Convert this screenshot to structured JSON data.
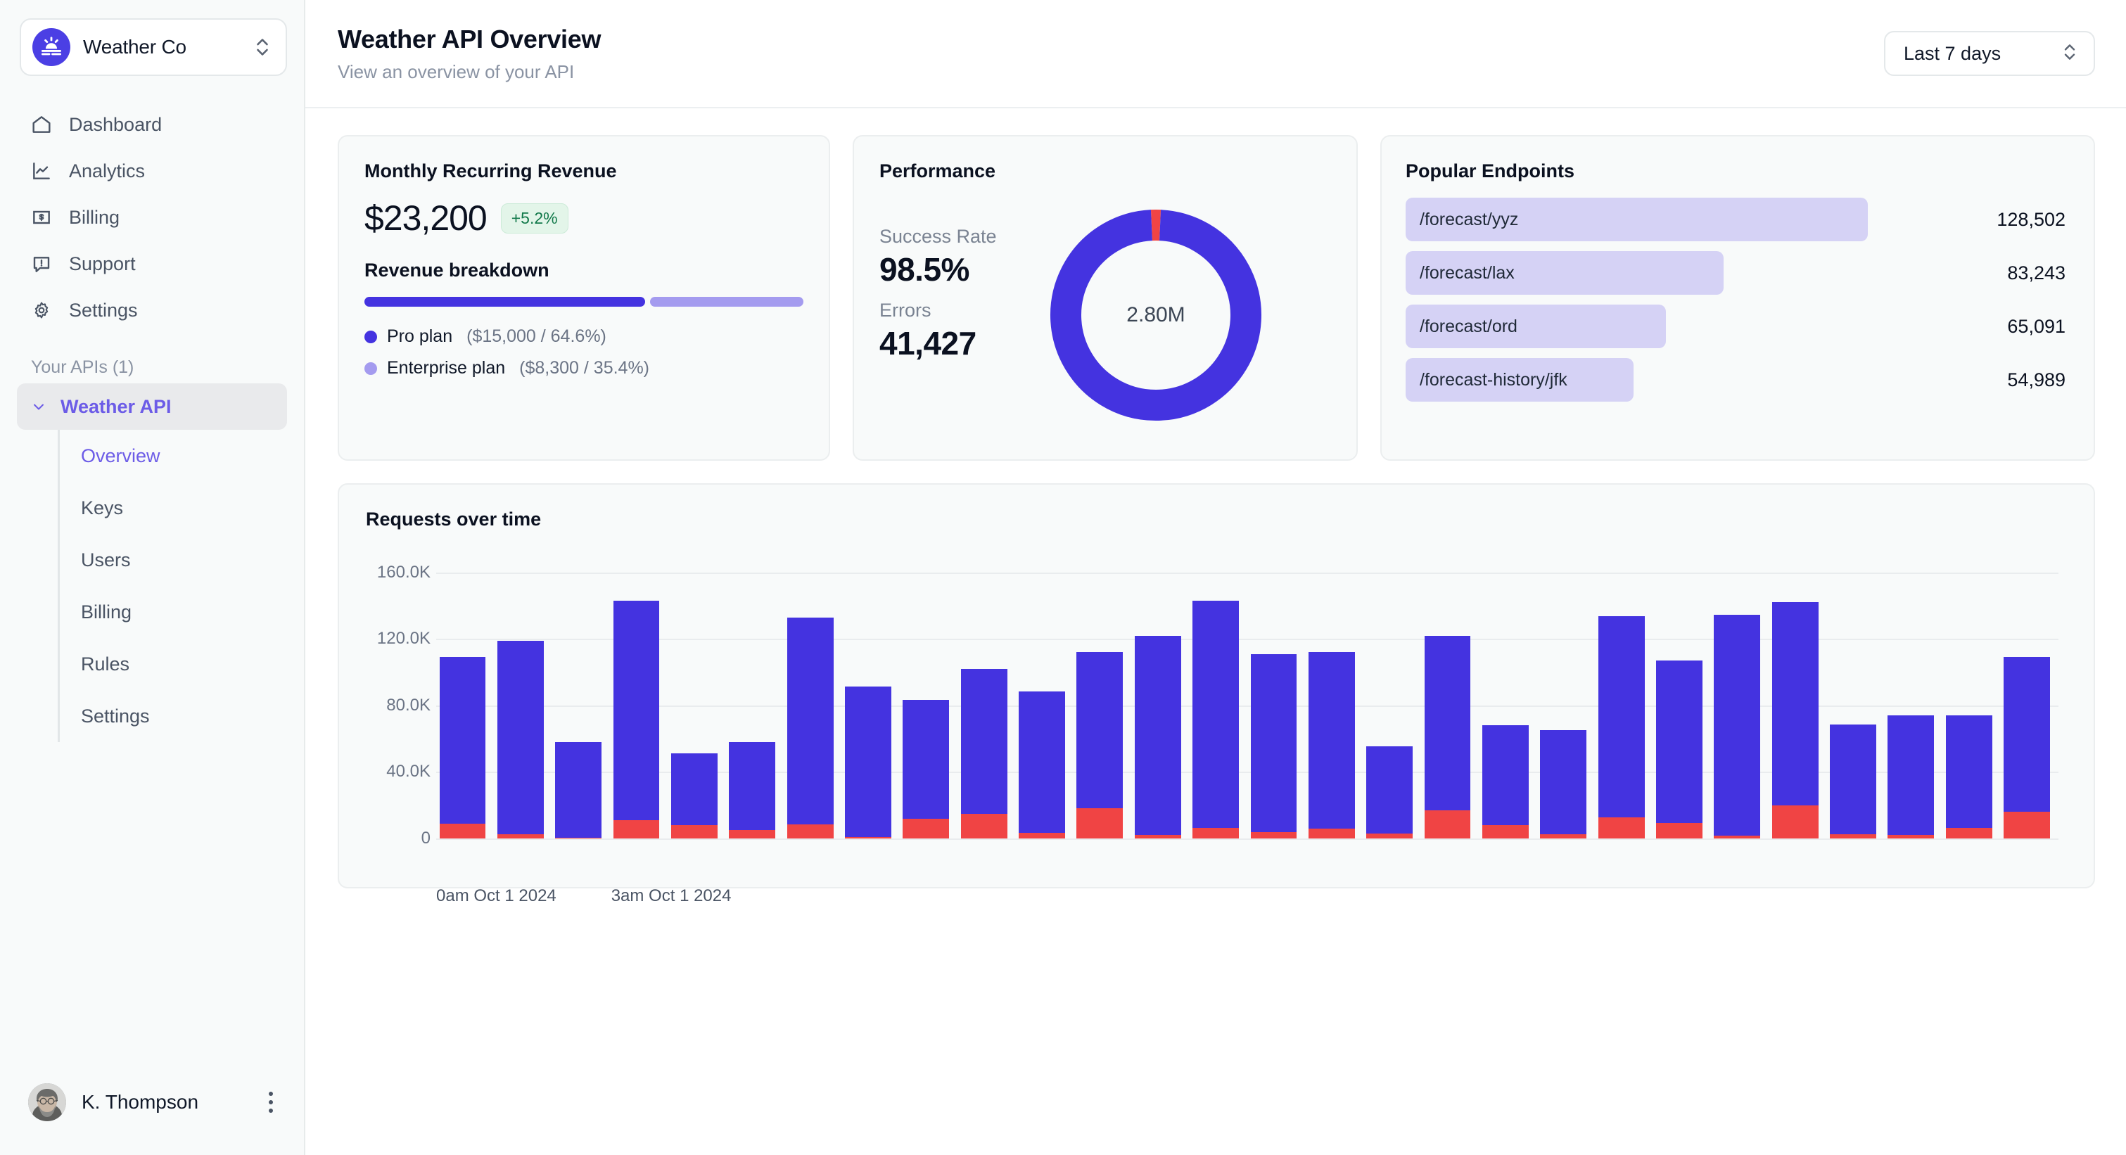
{
  "sidebar": {
    "org": {
      "name": "Weather Co",
      "logo_icon": "weather-sunrise-icon",
      "stepper_icon": "chevron-up-down-icon"
    },
    "nav": [
      {
        "label": "Dashboard",
        "icon": "home-icon"
      },
      {
        "label": "Analytics",
        "icon": "chart-line-icon"
      },
      {
        "label": "Billing",
        "icon": "dollar-box-icon"
      },
      {
        "label": "Support",
        "icon": "chat-alert-icon"
      },
      {
        "label": "Settings",
        "icon": "gear-icon"
      }
    ],
    "apis_section_label": "Your APIs (1)",
    "api": {
      "name": "Weather API",
      "expanded_icon": "chevron-down-icon",
      "children": [
        {
          "label": "Overview",
          "active": true
        },
        {
          "label": "Keys",
          "active": false
        },
        {
          "label": "Users",
          "active": false
        },
        {
          "label": "Billing",
          "active": false
        },
        {
          "label": "Rules",
          "active": false
        },
        {
          "label": "Settings",
          "active": false
        }
      ]
    },
    "user": {
      "name": "K. Thompson",
      "menu_icon": "more-vertical-icon",
      "avatar": "user-avatar"
    }
  },
  "header": {
    "title": "Weather API Overview",
    "subtitle": "View an overview of your API",
    "range": {
      "value": "Last 7 days",
      "icon": "chevron-up-down-icon"
    }
  },
  "mrr": {
    "title": "Monthly Recurring Revenue",
    "value": "$23,200",
    "change": "+5.2%",
    "breakdown_title": "Revenue breakdown",
    "segments": [
      {
        "name": "Pro plan",
        "meta": "($15,000 / 64.6%)",
        "percent": 64.6,
        "color": "#4433E0"
      },
      {
        "name": "Enterprise plan",
        "meta": "($8,300 / 35.4%)",
        "percent": 35.4,
        "color": "#A49BEF"
      }
    ]
  },
  "performance": {
    "title": "Performance",
    "success_label": "Success Rate",
    "success_value": "98.5%",
    "errors_label": "Errors",
    "errors_value": "41,427",
    "donut_center": "2.80M",
    "success_pct": 98.5,
    "error_pct": 1.5,
    "success_color": "#4433E0",
    "error_color": "#F04444"
  },
  "endpoints": {
    "title": "Popular Endpoints",
    "rows": [
      {
        "path": "/forecast/yyz",
        "count": "128,502",
        "value": 128502
      },
      {
        "path": "/forecast/lax",
        "count": "83,243",
        "value": 83243
      },
      {
        "path": "/forecast/ord",
        "count": "65,091",
        "value": 65091
      },
      {
        "path": "/forecast-history/jfk",
        "count": "54,989",
        "value": 54989
      }
    ],
    "bar_color": "#D5D2F5"
  },
  "chart_data": {
    "type": "bar",
    "title": "Requests over time",
    "stacked": true,
    "xlabel": "",
    "ylabel": "",
    "ylim": [
      0,
      170000
    ],
    "grid": true,
    "ytick_labels": [
      "0",
      "40.0K",
      "80.0K",
      "120.0K",
      "160.0K"
    ],
    "ytick_values": [
      0,
      40000,
      80000,
      120000,
      160000
    ],
    "xtick_labels": [
      "0am Oct 1 2024",
      "3am Oct 1 2024"
    ],
    "xtick_indices": [
      0,
      3
    ],
    "series": [
      {
        "name": "Errors",
        "color": "#F04444",
        "values": [
          9000,
          2500,
          500,
          11000,
          8000,
          5000,
          8500,
          1000,
          12000,
          15000,
          3500,
          18000,
          2000,
          6500,
          4000,
          6000,
          3000,
          17000,
          8000,
          2500,
          12500,
          9500,
          1500,
          20000,
          2500,
          2000,
          6500,
          16000
        ]
      },
      {
        "name": "Success",
        "color": "#4433E0",
        "values": [
          100000,
          116500,
          57500,
          132000,
          43000,
          53000,
          124500,
          90500,
          71500,
          87000,
          85000,
          94000,
          120000,
          136500,
          107000,
          106000,
          52500,
          105000,
          60000,
          62500,
          121000,
          97500,
          133000,
          122000,
          66000,
          72000,
          67500,
          93000
        ]
      }
    ],
    "totals": [
      109000,
      119000,
      58000,
      143000,
      51000,
      58000,
      133000,
      91500,
      83500,
      102000,
      88500,
      112000,
      122000,
      143000,
      111000,
      112000,
      55500,
      122000,
      68000,
      65000,
      133500,
      107000,
      134500,
      142000,
      68500,
      74000,
      74000,
      109000
    ]
  }
}
